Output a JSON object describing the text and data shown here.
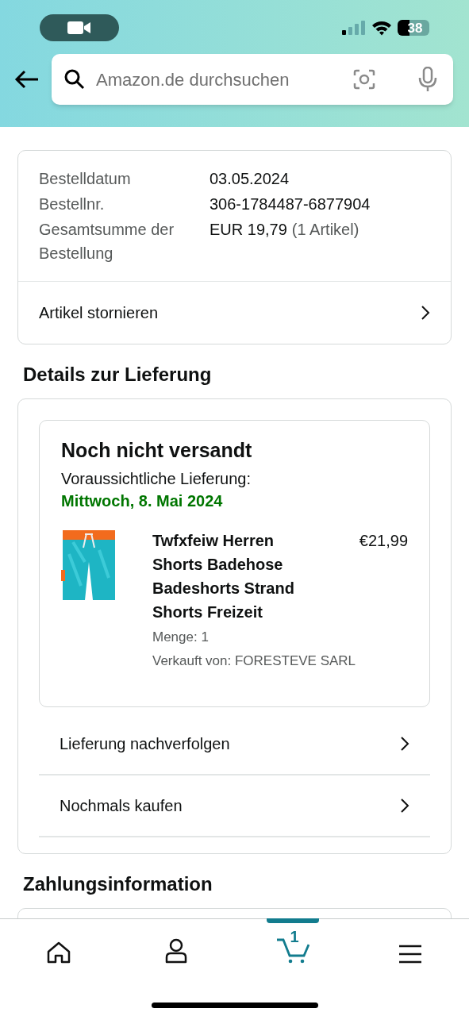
{
  "status_bar": {
    "battery": "38"
  },
  "search": {
    "placeholder": "Amazon.de durchsuchen"
  },
  "order_summary": {
    "rows": [
      {
        "label": "Bestelldatum",
        "value": "03.05.2024"
      },
      {
        "label": "Bestellnr.",
        "value": "306-1784487-6877904"
      },
      {
        "label": "Gesamtsumme der Bestellung",
        "value": "EUR 19,79",
        "note": "(1 Artikel)"
      }
    ],
    "action": "Artikel stornieren"
  },
  "delivery": {
    "heading": "Details zur Lieferung",
    "status": "Noch nicht versandt",
    "estimate_label": "Voraussichtliche Lieferung:",
    "estimate_date": "Mittwoch, 8. Mai 2024",
    "item": {
      "kind": "picture",
      "title": "Twfxfeiw Herren Shorts Badehose Badeshorts Strand Shorts Freizeit",
      "price": "€21,99",
      "quantity": "Menge: 1",
      "seller": "Verkauft von: FORESTEVE SARL"
    },
    "actions": [
      "Lieferung nachverfolgen",
      "Nochmals kaufen"
    ]
  },
  "payment": {
    "heading": "Zahlungsinformation"
  },
  "bottom_nav": [
    {
      "kind": "home",
      "selected": false
    },
    {
      "kind": "account",
      "selected": false
    },
    {
      "kind": "cart",
      "selected": true,
      "badge": "1"
    },
    {
      "kind": "menu",
      "selected": false
    }
  ]
}
